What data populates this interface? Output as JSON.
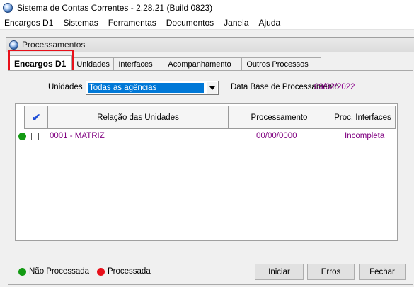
{
  "app": {
    "title": "Sistema de Contas Correntes - 2.28.21 (Build 0823)"
  },
  "menu": [
    "Encargos D1",
    "Sistemas",
    "Ferramentas",
    "Documentos",
    "Janela",
    "Ajuda"
  ],
  "window": {
    "title": "Processamentos"
  },
  "tabs": [
    {
      "label": "Encargos D1",
      "active": true
    },
    {
      "label": "Unidades"
    },
    {
      "label": "Interfaces"
    },
    {
      "label": "Acompanhamento"
    },
    {
      "label": "Outros Processos"
    }
  ],
  "filter": {
    "unidades_label": "Unidades",
    "unidades_value": "Todas as agências",
    "data_base_label": "Data Base de Processamento",
    "data_base_value": "09/02/2022"
  },
  "grid": {
    "columns": [
      "Relação das Unidades",
      "Processamento",
      "Proc. Interfaces"
    ],
    "rows": [
      {
        "status": "nao-processada",
        "checked": false,
        "unidade": "0001 - MATRIZ",
        "processamento": "00/00/0000",
        "interfaces": "Incompleta"
      }
    ]
  },
  "legend": {
    "nao_processada": "Não Processada",
    "processada": "Processada"
  },
  "buttons": {
    "iniciar": "Iniciar",
    "erros": "Erros",
    "fechar": "Fechar"
  },
  "colors": {
    "nao_processada": "#139a13",
    "processada": "#e8101a",
    "accent": "#0078d7",
    "data_text": "#800080",
    "highlight": "#e8101a"
  }
}
